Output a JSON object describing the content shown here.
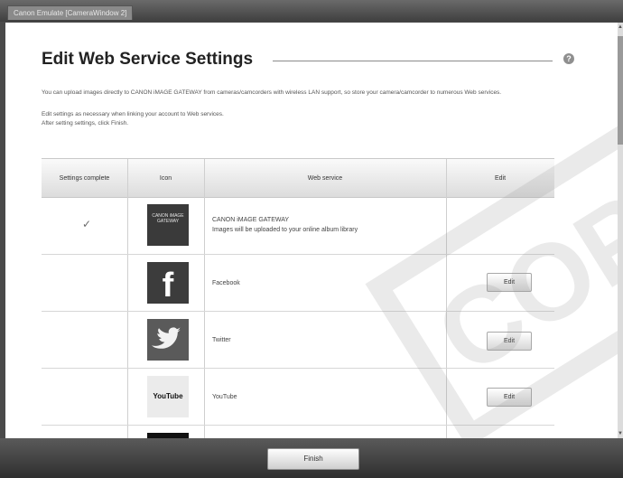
{
  "window": {
    "tab_title": "Canon Emulate [CameraWindow 2]"
  },
  "header": {
    "title": "Edit Web Service Settings",
    "help_icon": "?"
  },
  "description": {
    "line1": "You can upload images directly to CANON iMAGE GATEWAY from cameras/camcorders with wireless LAN support, so store your camera/camcorder to numerous Web services.",
    "line2": "Edit settings as necessary when linking your account to Web services.",
    "line3": "After setting settings, click Finish."
  },
  "table": {
    "headers": {
      "settings": "Settings complete",
      "icon": "Icon",
      "service": "Web service",
      "edit": "Edit"
    },
    "rows": [
      {
        "complete": "✓",
        "icon": "canon-image-gateway-icon",
        "icon_text": "CANON iMAGE GATEWAY",
        "name": "CANON iMAGE GATEWAY",
        "subtitle": "Images will be uploaded to your online album library",
        "edit": ""
      },
      {
        "complete": "",
        "icon": "facebook-icon",
        "icon_text": "f",
        "name": "Facebook",
        "subtitle": "",
        "edit": "Edit"
      },
      {
        "complete": "",
        "icon": "twitter-icon",
        "icon_text": "",
        "name": "Twitter",
        "subtitle": "",
        "edit": "Edit"
      },
      {
        "complete": "",
        "icon": "youtube-icon",
        "icon_text": "YouTube",
        "name": "YouTube",
        "subtitle": "",
        "edit": "Edit"
      }
    ]
  },
  "footer": {
    "finish_label": "Finish"
  },
  "watermark": {
    "text": "COP"
  }
}
